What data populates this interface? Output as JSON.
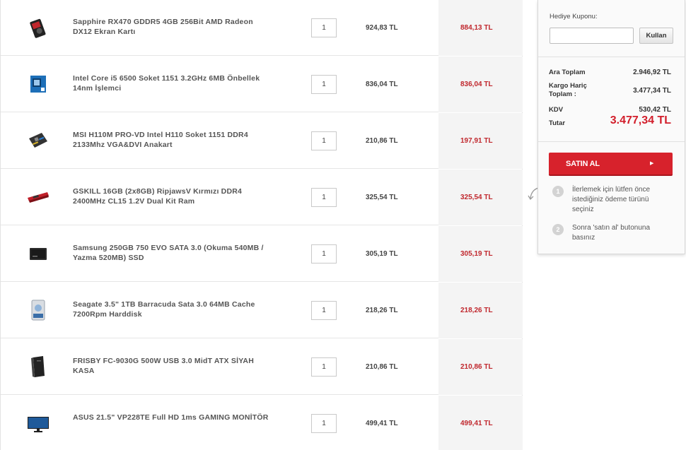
{
  "cart": {
    "items": [
      {
        "name": "Sapphire RX470 GDDR5 4GB 256Bit AMD Radeon DX12 Ekran Kartı",
        "qty": "1",
        "price": "924,83 TL",
        "discount_price": "884,13 TL",
        "icon": "graphics-card-icon"
      },
      {
        "name": "Intel Core i5 6500 Soket 1151 3.2GHz 6MB Önbellek 14nm İşlemci",
        "qty": "1",
        "price": "836,04 TL",
        "discount_price": "836,04 TL",
        "icon": "cpu-box-icon"
      },
      {
        "name": "MSI H110M PRO-VD Intel H110 Soket 1151 DDR4 2133Mhz VGA&DVI Anakart",
        "qty": "1",
        "price": "210,86 TL",
        "discount_price": "197,91 TL",
        "icon": "motherboard-icon"
      },
      {
        "name": "GSKILL 16GB (2x8GB) RipjawsV Kırmızı DDR4 2400MHz CL15 1.2V Dual Kit Ram",
        "qty": "1",
        "price": "325,54 TL",
        "discount_price": "325,54 TL",
        "icon": "ram-icon"
      },
      {
        "name": "Samsung 250GB 750 EVO SATA 3.0 (Okuma 540MB / Yazma 520MB) SSD",
        "qty": "1",
        "price": "305,19 TL",
        "discount_price": "305,19 TL",
        "icon": "ssd-icon"
      },
      {
        "name": "Seagate 3.5\" 1TB Barracuda Sata 3.0 64MB Cache 7200Rpm Harddisk",
        "qty": "1",
        "price": "218,26 TL",
        "discount_price": "218,26 TL",
        "icon": "hard-disk-icon"
      },
      {
        "name": "FRISBY FC-9030G 500W USB 3.0 MidT ATX SİYAH KASA",
        "qty": "1",
        "price": "210,86 TL",
        "discount_price": "210,86 TL",
        "icon": "pc-case-icon"
      },
      {
        "name": "ASUS 21.5\" VP228TE Full HD 1ms GAMING MONİTÖR",
        "qty": "1",
        "price": "499,41 TL",
        "discount_price": "499,41 TL",
        "icon": "monitor-icon"
      }
    ]
  },
  "summary": {
    "coupon_label": "Hediye Kuponu:",
    "coupon_value": "",
    "coupon_button": "Kullan",
    "subtotal_label": "Ara Toplam",
    "subtotal_value": "2.946,92 TL",
    "excl_shipping_label_1": "Kargo Hariç",
    "excl_shipping_label_2": "Toplam :",
    "excl_shipping_value": "3.477,34 TL",
    "vat_label": "KDV",
    "vat_value": "530,42 TL",
    "total_label": "Tutar",
    "total_value": "3.477,34 TL",
    "buy_button": "SATIN AL",
    "steps": [
      {
        "num": "1",
        "text": "İlerlemek için lütfen önce istediğiniz ödeme türünü seçiniz"
      },
      {
        "num": "2",
        "text": "Sonra 'satın al' butonuna basınız"
      }
    ]
  },
  "colors": {
    "accent": "#d7222c",
    "discount": "#c0272d",
    "total": "#d21e2b"
  }
}
